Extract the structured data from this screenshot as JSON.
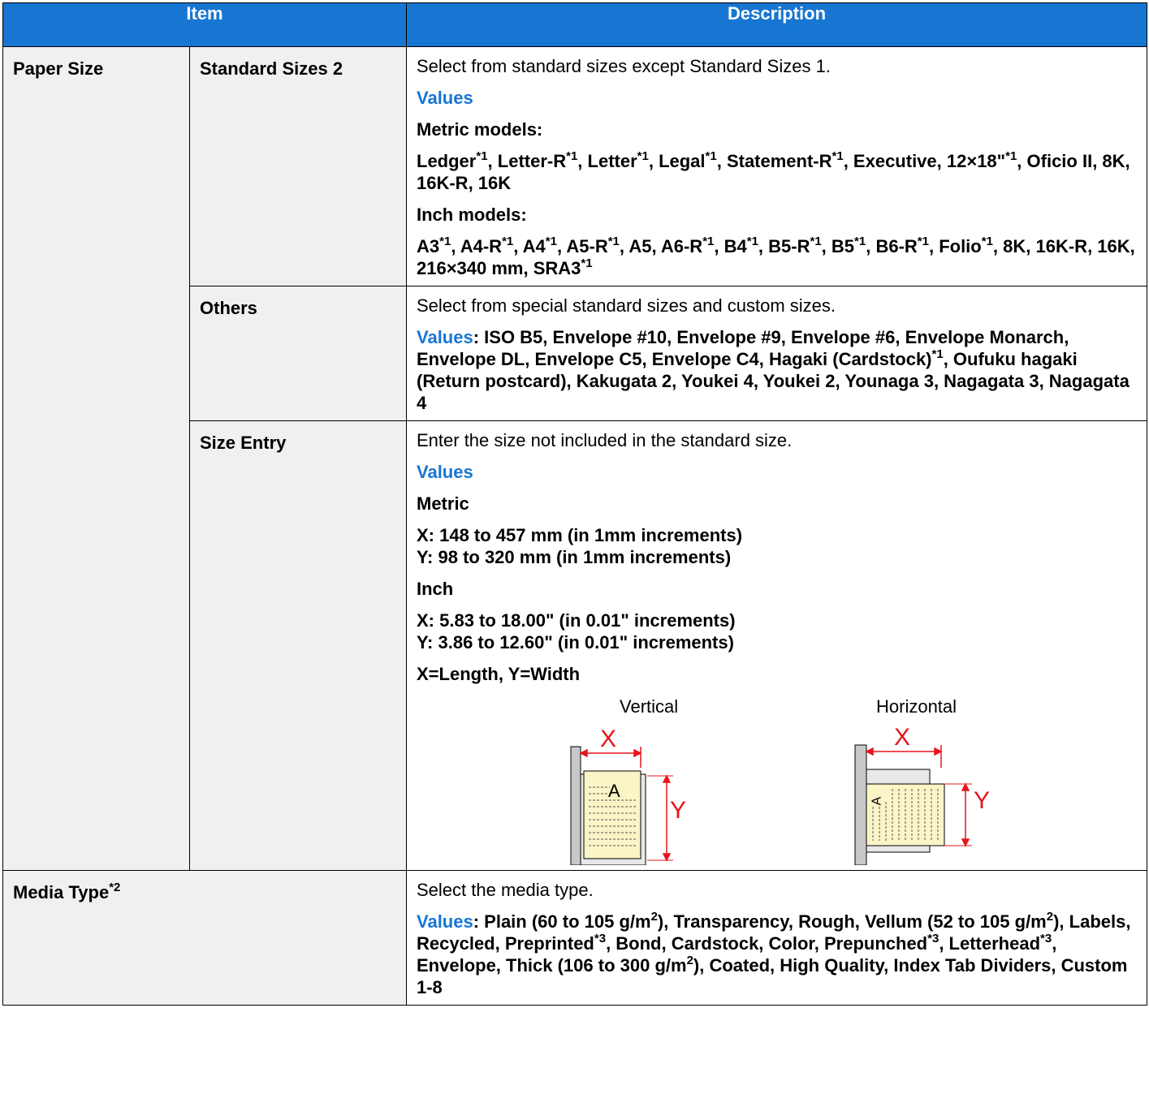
{
  "header": {
    "item": "Item",
    "description": "Description"
  },
  "rows": {
    "paper_size": {
      "label": "Paper Size",
      "standard_sizes_2": {
        "label": "Standard Sizes 2",
        "intro": "Select from standard sizes except Standard Sizes 1.",
        "values_label": "Values",
        "metric_label": "Metric models:",
        "metric_values": [
          "Ledger",
          "*1",
          ", Letter-R",
          "*1",
          ", Letter",
          "*1",
          ", Legal",
          "*1",
          ", Statement-R",
          "*1",
          ", Executive, 12×18\"",
          "*1",
          ", Oficio II, 8K, 16K-R, 16K"
        ],
        "inch_label": "Inch models:",
        "inch_values": [
          "A3",
          "*1",
          ", A4-R",
          "*1",
          ", A4",
          "*1",
          ", A5-R",
          "*1",
          ", A5, A6-R",
          "*1",
          ", B4",
          "*1",
          ", B5-R",
          "*1",
          ", B5",
          "*1",
          ", B6-R",
          "*1",
          ", Folio",
          "*1",
          ", 8K, 16K-R, 16K, 216×340 mm, SRA3",
          "*1"
        ]
      },
      "others": {
        "label": "Others",
        "intro": "Select from special standard sizes and custom sizes.",
        "values_label": "Values",
        "colon": ":",
        "values_a": " ISO B5, Envelope #10, Envelope #9, Envelope #6, Envelope Monarch, Envelope DL, Envelope C5, Envelope C4, Hagaki (Cardstock)",
        "sup": "*1",
        "values_b": ", Oufuku hagaki (Return postcard), Kakugata 2, Youkei 4, Youkei 2, Younaga 3, Nagagata 3, Nagagata 4"
      },
      "size_entry": {
        "label": "Size Entry",
        "intro": "Enter the size not included in the standard size.",
        "values_label": "Values",
        "metric_label": "Metric",
        "metric_x": "X: 148 to 457 mm (in 1mm increments)",
        "metric_y": "Y: 98 to 320 mm (in 1mm increments)",
        "inch_label": "Inch",
        "inch_x": "X: 5.83 to 18.00\" (in 0.01\" increments)",
        "inch_y": "Y: 3.86 to 12.60\" (in 0.01\" increments)",
        "xy_note": "X=Length, Y=Width",
        "figure_vertical": {
          "title": "Vertical",
          "x": "X",
          "y": "Y",
          "page_glyph": "A"
        },
        "figure_horizontal": {
          "title": "Horizontal",
          "x": "X",
          "y": "Y",
          "page_glyph": "A"
        }
      }
    },
    "media_type": {
      "label": "Media Type",
      "label_sup": "*2",
      "intro": "Select the media type.",
      "values_label": "Values",
      "colon": ":",
      "parts": [
        " Plain (60 to 105 g/m",
        "2",
        "), Transparency, Rough, Vellum (52 to 105 g/m",
        "2",
        "), Labels, Recycled, Preprinted",
        "*3",
        ", Bond, Cardstock, Color, Prepunched",
        "*3",
        ", Letterhead",
        "*3",
        ", Envelope, Thick (106 to 300 g/m",
        "2",
        "), Coated, High Quality, Index Tab Dividers, Custom 1-8"
      ]
    }
  },
  "colors": {
    "header_bg": "#1776d2",
    "accent": "#1776d2",
    "dimension": "#e8141b",
    "paper": "#faf4c6"
  }
}
